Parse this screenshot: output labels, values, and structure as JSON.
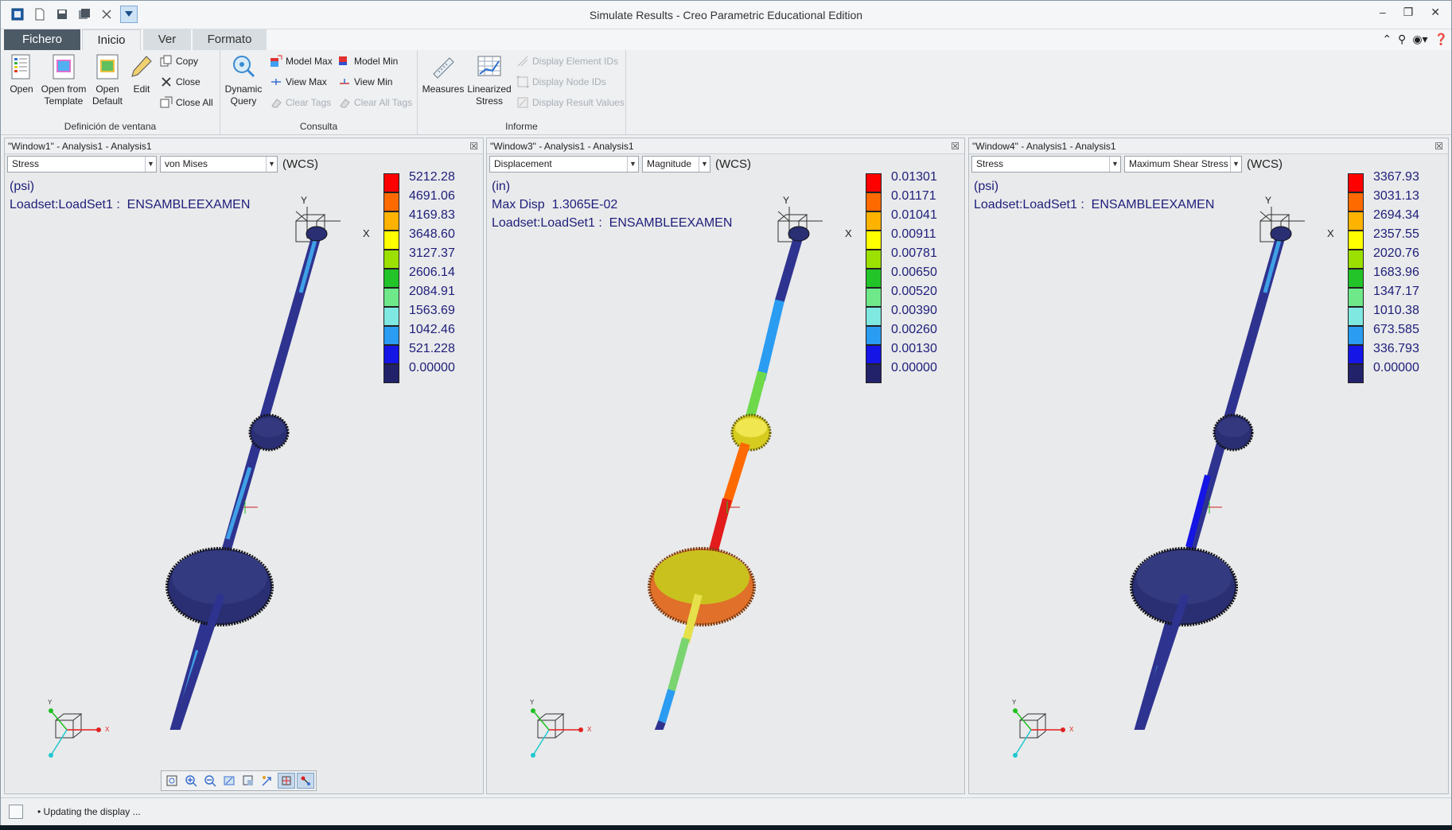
{
  "app": {
    "title": "Simulate Results - Creo Parametric Educational Edition"
  },
  "tabs": [
    {
      "label": "Fichero"
    },
    {
      "label": "Inicio"
    },
    {
      "label": "Ver"
    },
    {
      "label": "Formato"
    }
  ],
  "ribbon": {
    "window_group": {
      "label": "Definición de ventana",
      "open": "Open",
      "open_template_1": "Open from",
      "open_template_2": "Template",
      "open_default_1": "Open",
      "open_default_2": "Default",
      "edit": "Edit",
      "copy": "Copy",
      "close": "Close",
      "close_all": "Close All"
    },
    "query_group": {
      "label": "Consulta",
      "dynamic_1": "Dynamic",
      "dynamic_2": "Query",
      "model_max": "Model Max",
      "model_min": "Model Min",
      "view_max": "View Max",
      "view_min": "View Min",
      "clear_tags": "Clear Tags",
      "clear_all_tags": "Clear All Tags"
    },
    "report_group": {
      "label": "Informe",
      "measures": "Measures",
      "linearized_1": "Linearized",
      "linearized_2": "Stress",
      "display_element_ids": "Display Element IDs",
      "display_node_ids": "Display Node IDs",
      "display_result_values": "Display Result Values"
    }
  },
  "windows": [
    {
      "header": "\"Window1\" - Analysis1 - Analysis1",
      "quantity": "Stress",
      "component": "von Mises",
      "csys": "(WCS)",
      "units": "(psi)",
      "info_line_1": "Loadset:LoadSet1 :  ENSAMBLEEXAMEN",
      "info_line_2": "",
      "legend_values": [
        "5212.28",
        "4691.06",
        "4169.83",
        "3648.60",
        "3127.37",
        "2606.14",
        "2084.91",
        "1563.69",
        "1042.46",
        "521.228",
        "0.00000"
      ]
    },
    {
      "header": "\"Window3\" - Analysis1 - Analysis1",
      "quantity": "Displacement",
      "component": "Magnitude",
      "csys": "(WCS)",
      "units": "(in)",
      "info_line_1": "Max Disp  1.3065E-02",
      "info_line_2": "Loadset:LoadSet1 :  ENSAMBLEEXAMEN",
      "legend_values": [
        "0.01301",
        "0.01171",
        "0.01041",
        "0.00911",
        "0.00781",
        "0.00650",
        "0.00520",
        "0.00390",
        "0.00260",
        "0.00130",
        "0.00000"
      ]
    },
    {
      "header": "\"Window4\" - Analysis1 - Analysis1",
      "quantity": "Stress",
      "component": "Maximum Shear Stress",
      "csys": "(WCS)",
      "units": "(psi)",
      "info_line_1": "Loadset:LoadSet1 :  ENSAMBLEEXAMEN",
      "info_line_2": "",
      "legend_values": [
        "3367.93",
        "3031.13",
        "2694.34",
        "2357.55",
        "2020.76",
        "1683.96",
        "1347.17",
        "1010.38",
        "673.585",
        "336.793",
        "0.00000"
      ]
    }
  ],
  "legend_colors": [
    "#ff0000",
    "#ff6a00",
    "#ffb300",
    "#ffff00",
    "#9be000",
    "#22c42a",
    "#6ee889",
    "#7fe8e0",
    "#2a9cf2",
    "#1515e6",
    "#22226a"
  ],
  "model_colors": {
    "w1": {
      "shaft": "#2e3390",
      "gear": "#2a2f73",
      "hot": "#3fa0e6"
    },
    "w3": {
      "shaft_top": "#2e3390",
      "shaft_mid": "#6ed94a",
      "shaft_red": "#e21b1b",
      "small_gear": "#e6e04a",
      "big_gear": "#c9c21e",
      "big_gear_rim": "#e0702a",
      "shaft_low": "#7ad470"
    },
    "w4": {
      "shaft": "#2e3390",
      "gear": "#2a2f73",
      "hot": "#3fa0e6"
    }
  },
  "status": {
    "text": "Updating the display ..."
  }
}
